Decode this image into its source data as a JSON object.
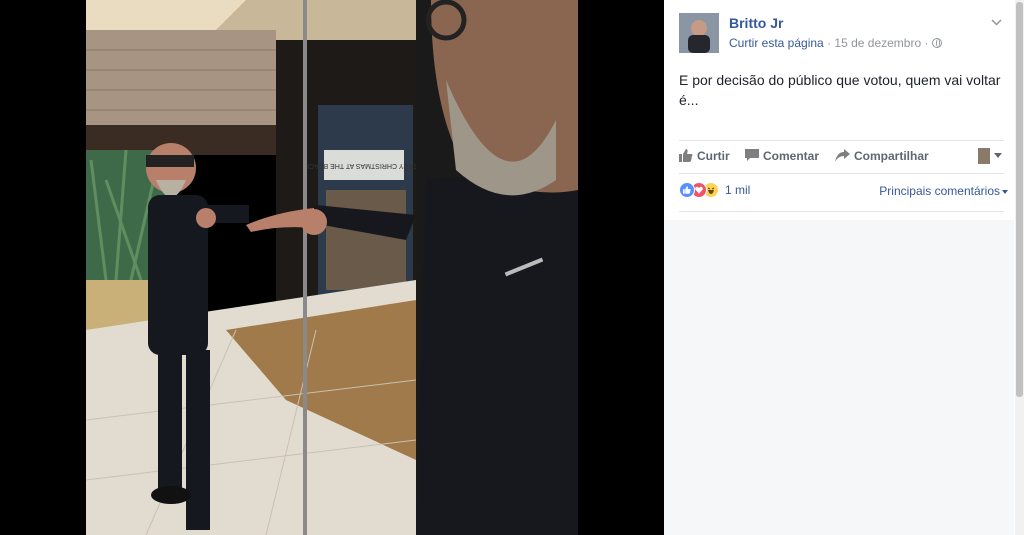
{
  "post": {
    "page_name": "Britto Jr",
    "like_page": "Curtir esta página",
    "separator": "·",
    "date": "15 de dezembro",
    "text": "E por decisão do público que votou, quem vai voltar é..."
  },
  "actions": {
    "like": "Curtir",
    "comment": "Comentar",
    "share": "Compartilhar"
  },
  "reactions": {
    "count": "1 mil",
    "types": [
      "like",
      "love",
      "haha"
    ],
    "sort_label": "Principais comentários"
  },
  "colors": {
    "link": "#365899",
    "like_blue": "#5890ff",
    "love_red": "#f25268",
    "haha_yellow": "#fcd257"
  },
  "photo": {
    "sign_text": "MERRY CHRISTMAS AT THE BEACH"
  }
}
